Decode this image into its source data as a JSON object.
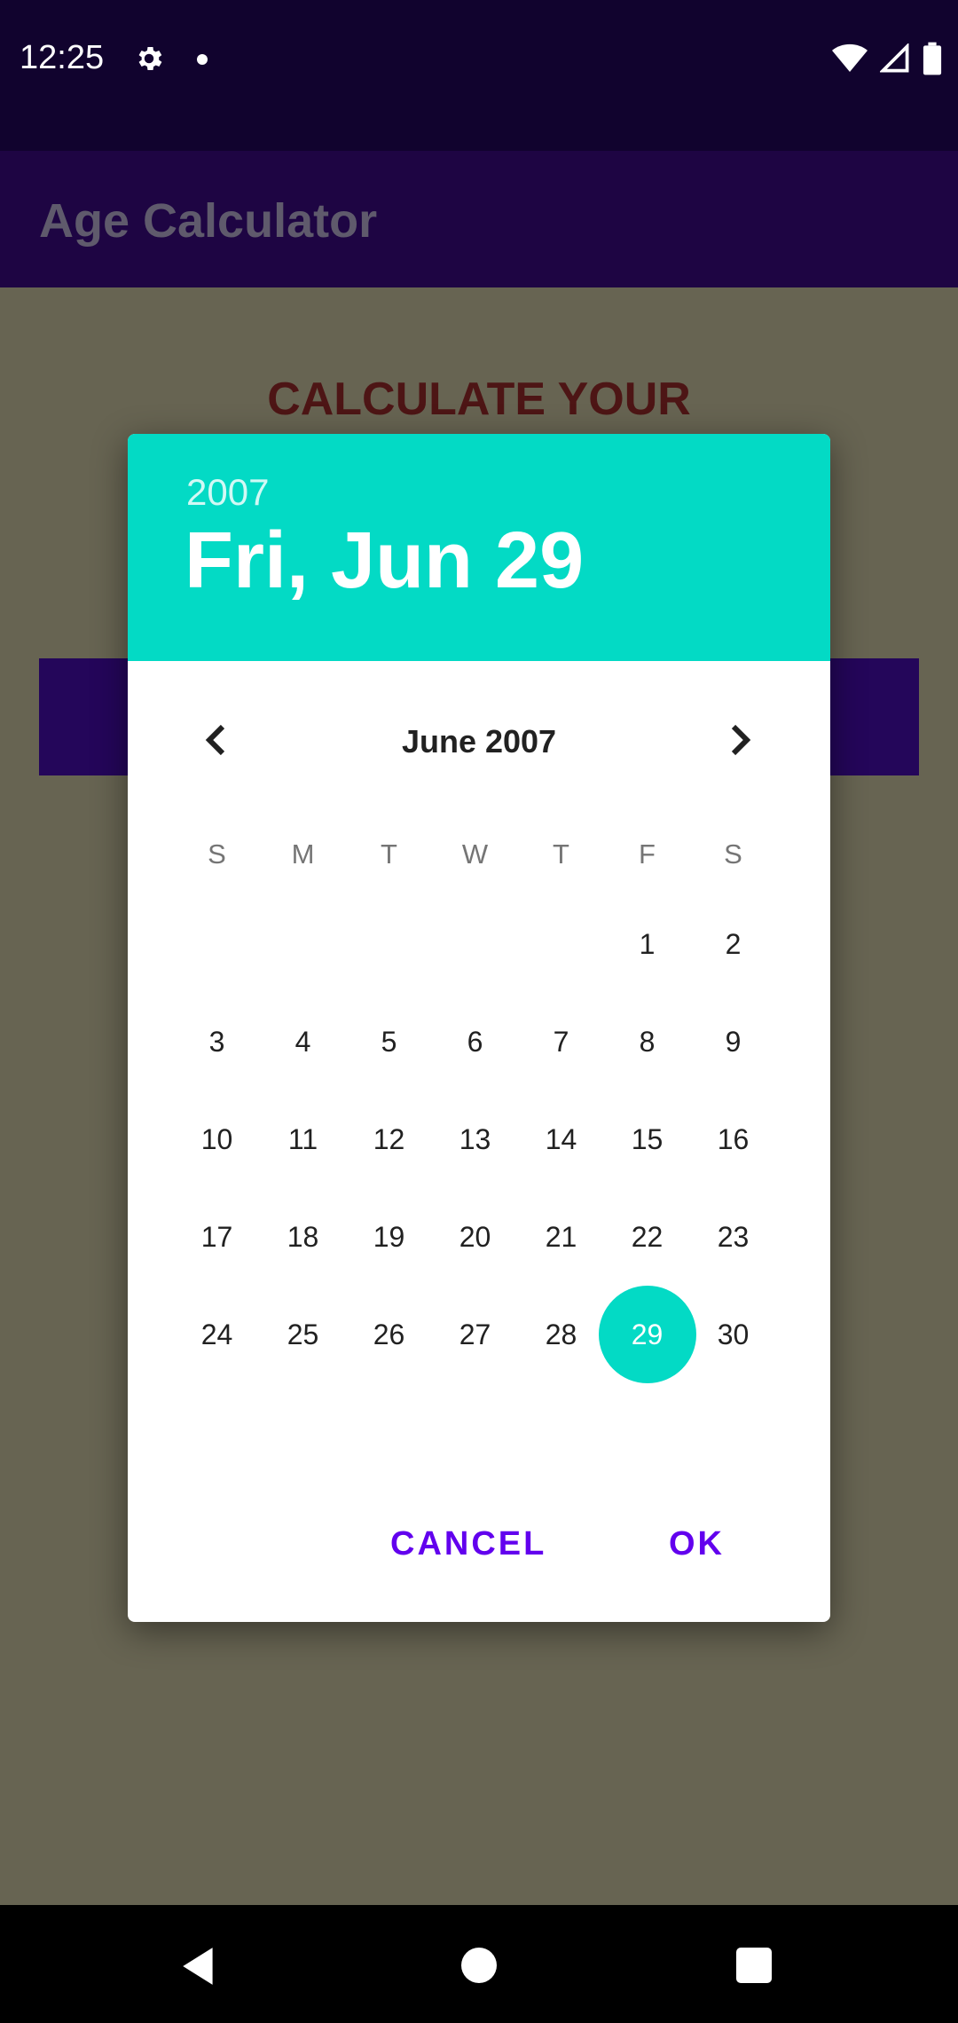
{
  "status_bar": {
    "time": "12:25",
    "icons": [
      "gear-icon",
      "dot-icon",
      "wifi-icon",
      "signal-icon",
      "battery-icon"
    ]
  },
  "app_bar": {
    "title": "Age Calculator"
  },
  "main": {
    "heading": "CALCULATE YOUR"
  },
  "date_picker": {
    "header_year": "2007",
    "header_date": "Fri, Jun 29",
    "month_label": "June 2007",
    "weekdays": [
      "S",
      "M",
      "T",
      "W",
      "T",
      "F",
      "S"
    ],
    "days": [
      "",
      "",
      "",
      "",
      "",
      "1",
      "2",
      "3",
      "4",
      "5",
      "6",
      "7",
      "8",
      "9",
      "10",
      "11",
      "12",
      "13",
      "14",
      "15",
      "16",
      "17",
      "18",
      "19",
      "20",
      "21",
      "22",
      "23",
      "24",
      "25",
      "26",
      "27",
      "28",
      "29",
      "30"
    ],
    "selected_day": "29",
    "cancel_label": "CANCEL",
    "ok_label": "OK",
    "accent_color": "#03dac5",
    "button_color": "#6200ee"
  },
  "nav_bar": {
    "icons": [
      "back-icon",
      "home-icon",
      "recents-icon"
    ]
  }
}
